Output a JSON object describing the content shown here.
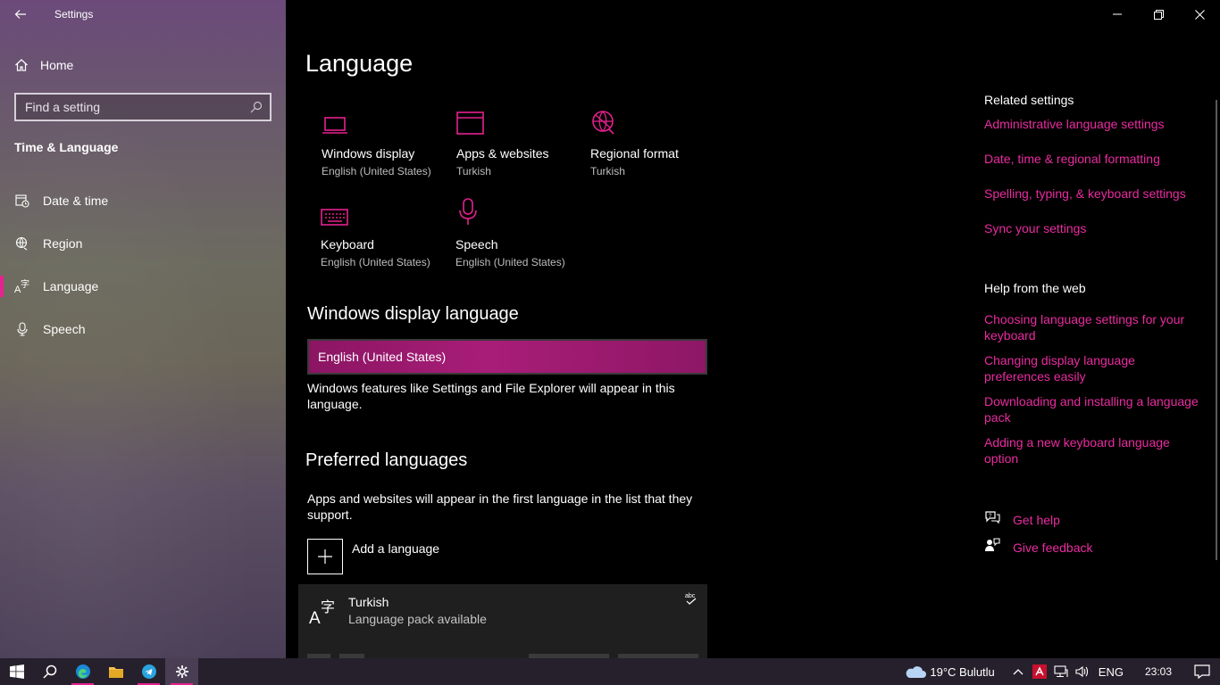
{
  "window": {
    "title": "Settings"
  },
  "sidebar": {
    "home_label": "Home",
    "search_placeholder": "Find a setting",
    "section": "Time & Language",
    "items": [
      {
        "label": "Date & time",
        "icon": "calendar-clock-icon"
      },
      {
        "label": "Region",
        "icon": "globe-icon"
      },
      {
        "label": "Language",
        "icon": "language-icon",
        "active": true
      },
      {
        "label": "Speech",
        "icon": "microphone-icon"
      }
    ]
  },
  "main": {
    "title": "Language",
    "tiles": [
      {
        "title": "Windows display",
        "subtitle": "English (United States)",
        "icon": "laptop-icon"
      },
      {
        "title": "Apps & websites",
        "subtitle": "Turkish",
        "icon": "browser-window-icon"
      },
      {
        "title": "Regional format",
        "subtitle": "Turkish",
        "icon": "globe-icon"
      },
      {
        "title": "Keyboard",
        "subtitle": "English (United States)",
        "icon": "keyboard-icon"
      },
      {
        "title": "Speech",
        "subtitle": "English (United States)",
        "icon": "microphone-icon"
      }
    ],
    "display_language": {
      "heading": "Windows display language",
      "selected": "English (United States)",
      "description": "Windows features like Settings and File Explorer will appear in this language."
    },
    "preferred": {
      "heading": "Preferred languages",
      "description": "Apps and websites will appear in the first language in the list that they support.",
      "add_label": "Add a language",
      "languages": [
        {
          "name": "Turkish",
          "status": "Language pack available"
        }
      ]
    }
  },
  "related": {
    "heading": "Related settings",
    "links": [
      "Administrative language settings",
      "Date, time & regional formatting",
      "Spelling, typing, & keyboard settings",
      "Sync your settings"
    ]
  },
  "help": {
    "heading": "Help from the web",
    "links": [
      "Choosing language settings for your keyboard",
      "Changing display language preferences easily",
      "Downloading and installing a language pack",
      "Adding a new keyboard language option"
    ],
    "get_help": "Get help",
    "give_feedback": "Give feedback"
  },
  "taskbar": {
    "weather": "19°C  Bulutlu",
    "input_lang": "ENG",
    "time": "23:03"
  },
  "colors": {
    "accent": "#e5208e",
    "link": "#ea2ba0"
  }
}
